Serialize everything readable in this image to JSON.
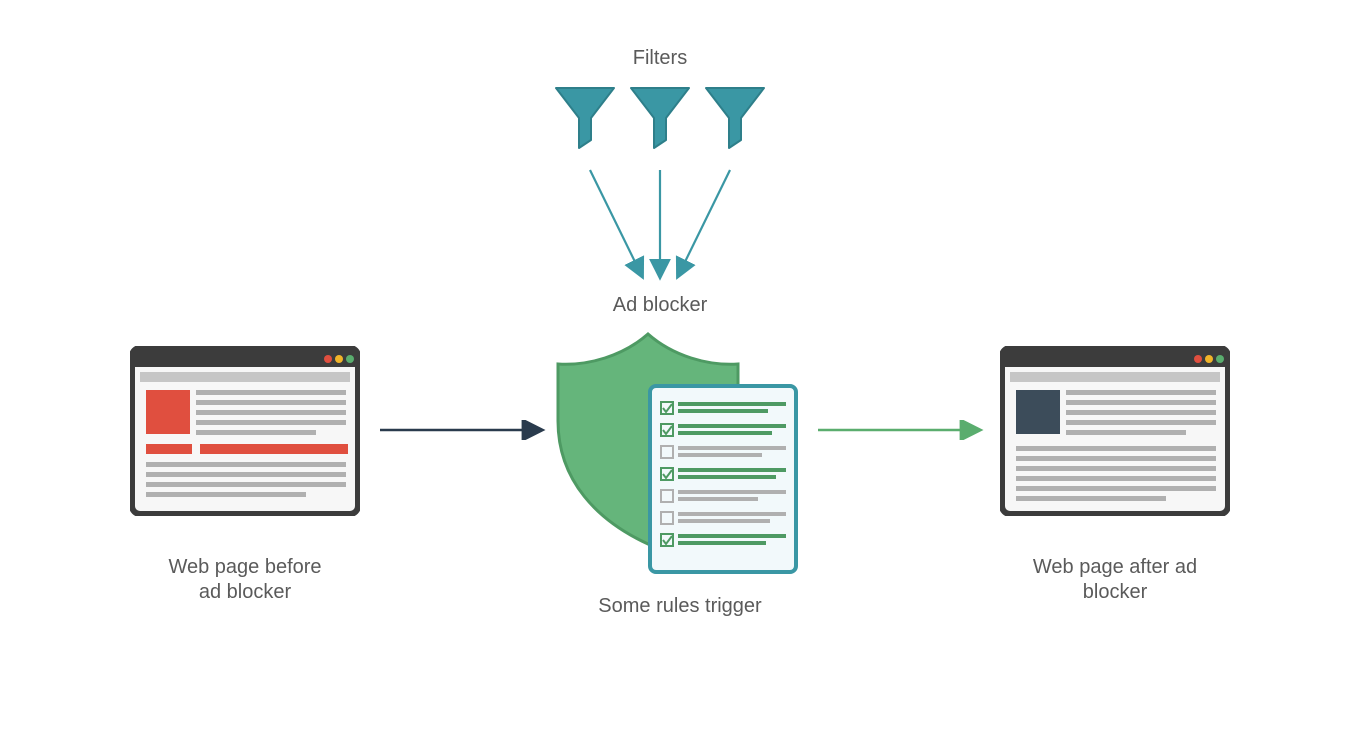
{
  "labels": {
    "filters": "Filters",
    "adblocker": "Ad blocker",
    "before": "Web page before\nad blocker",
    "rules": "Some rules trigger",
    "after": "Web page after ad\nblocker"
  },
  "colors": {
    "teal": "#3a97a4",
    "tealStroke": "#2e7f8a",
    "shield": "#65b57b",
    "shieldStroke": "#4e9a63",
    "navy": "#2a3b4d",
    "greenArrow": "#5aad6e",
    "frame": "#3c3c3c",
    "chromeBar": "#c6c6c6",
    "adRed": "#e04f3f",
    "trafficRed": "#e04f3f",
    "trafficYellow": "#f0b429",
    "trafficGreen": "#5aad6e",
    "greyLine": "#b0b0b0",
    "docBorder": "#3a97a4",
    "docBg": "#f2f9fb",
    "ruleGreen": "#4e9a63",
    "content": "#3c4c5a"
  }
}
